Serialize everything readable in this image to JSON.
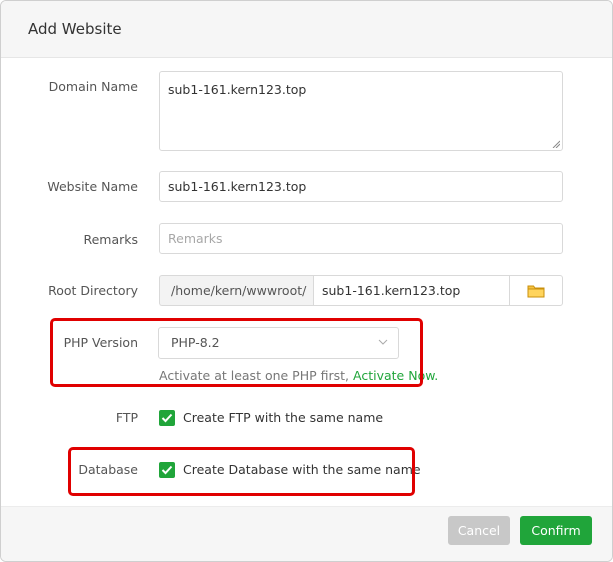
{
  "dialog": {
    "title": "Add Website"
  },
  "form": {
    "domain_label": "Domain Name",
    "domain_value": "sub1-161.kern123.top",
    "website_label": "Website Name",
    "website_value": "sub1-161.kern123.top",
    "remarks_label": "Remarks",
    "remarks_placeholder": "Remarks",
    "root_label": "Root Directory",
    "root_prefix": "/home/kern/wwwroot/",
    "root_value": "sub1-161.kern123.top",
    "php_label": "PHP Version",
    "php_value": "PHP-8.2",
    "php_hint": "Activate at least one PHP first,",
    "php_hint_link": "Activate Now.",
    "ftp_label": "FTP",
    "ftp_checkbox_label": "Create FTP with the same name",
    "ftp_checked": true,
    "db_label": "Database",
    "db_checkbox_label": "Create Database with the same name",
    "db_checked": true
  },
  "footer": {
    "cancel_label": "Cancel",
    "confirm_label": "Confirm"
  },
  "colors": {
    "accent": "#20a53a",
    "highlight": "#e00000",
    "disabled": "#c8c8c8"
  }
}
